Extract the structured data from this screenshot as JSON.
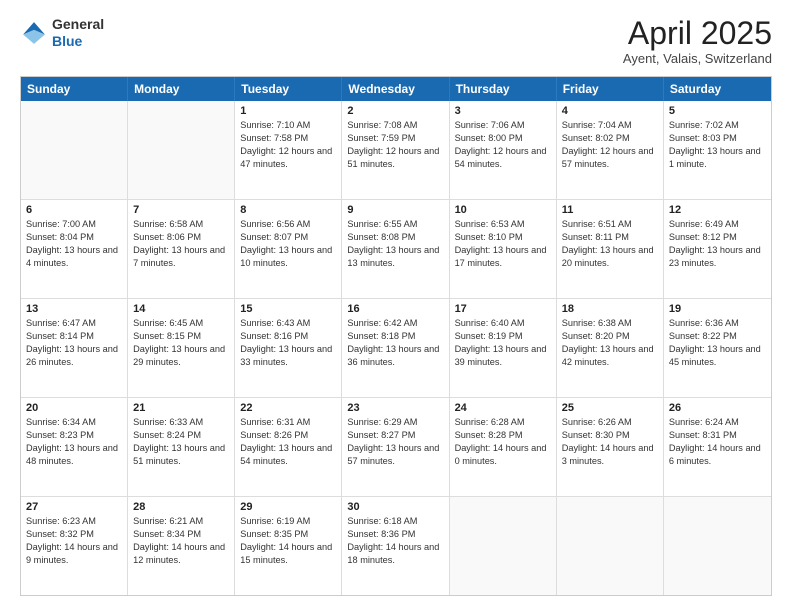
{
  "header": {
    "logo_general": "General",
    "logo_blue": "Blue",
    "month_title": "April 2025",
    "location": "Ayent, Valais, Switzerland"
  },
  "days_of_week": [
    "Sunday",
    "Monday",
    "Tuesday",
    "Wednesday",
    "Thursday",
    "Friday",
    "Saturday"
  ],
  "weeks": [
    [
      {
        "day": "",
        "sunrise": "",
        "sunset": "",
        "daylight": ""
      },
      {
        "day": "",
        "sunrise": "",
        "sunset": "",
        "daylight": ""
      },
      {
        "day": "1",
        "sunrise": "Sunrise: 7:10 AM",
        "sunset": "Sunset: 7:58 PM",
        "daylight": "Daylight: 12 hours and 47 minutes."
      },
      {
        "day": "2",
        "sunrise": "Sunrise: 7:08 AM",
        "sunset": "Sunset: 7:59 PM",
        "daylight": "Daylight: 12 hours and 51 minutes."
      },
      {
        "day": "3",
        "sunrise": "Sunrise: 7:06 AM",
        "sunset": "Sunset: 8:00 PM",
        "daylight": "Daylight: 12 hours and 54 minutes."
      },
      {
        "day": "4",
        "sunrise": "Sunrise: 7:04 AM",
        "sunset": "Sunset: 8:02 PM",
        "daylight": "Daylight: 12 hours and 57 minutes."
      },
      {
        "day": "5",
        "sunrise": "Sunrise: 7:02 AM",
        "sunset": "Sunset: 8:03 PM",
        "daylight": "Daylight: 13 hours and 1 minute."
      }
    ],
    [
      {
        "day": "6",
        "sunrise": "Sunrise: 7:00 AM",
        "sunset": "Sunset: 8:04 PM",
        "daylight": "Daylight: 13 hours and 4 minutes."
      },
      {
        "day": "7",
        "sunrise": "Sunrise: 6:58 AM",
        "sunset": "Sunset: 8:06 PM",
        "daylight": "Daylight: 13 hours and 7 minutes."
      },
      {
        "day": "8",
        "sunrise": "Sunrise: 6:56 AM",
        "sunset": "Sunset: 8:07 PM",
        "daylight": "Daylight: 13 hours and 10 minutes."
      },
      {
        "day": "9",
        "sunrise": "Sunrise: 6:55 AM",
        "sunset": "Sunset: 8:08 PM",
        "daylight": "Daylight: 13 hours and 13 minutes."
      },
      {
        "day": "10",
        "sunrise": "Sunrise: 6:53 AM",
        "sunset": "Sunset: 8:10 PM",
        "daylight": "Daylight: 13 hours and 17 minutes."
      },
      {
        "day": "11",
        "sunrise": "Sunrise: 6:51 AM",
        "sunset": "Sunset: 8:11 PM",
        "daylight": "Daylight: 13 hours and 20 minutes."
      },
      {
        "day": "12",
        "sunrise": "Sunrise: 6:49 AM",
        "sunset": "Sunset: 8:12 PM",
        "daylight": "Daylight: 13 hours and 23 minutes."
      }
    ],
    [
      {
        "day": "13",
        "sunrise": "Sunrise: 6:47 AM",
        "sunset": "Sunset: 8:14 PM",
        "daylight": "Daylight: 13 hours and 26 minutes."
      },
      {
        "day": "14",
        "sunrise": "Sunrise: 6:45 AM",
        "sunset": "Sunset: 8:15 PM",
        "daylight": "Daylight: 13 hours and 29 minutes."
      },
      {
        "day": "15",
        "sunrise": "Sunrise: 6:43 AM",
        "sunset": "Sunset: 8:16 PM",
        "daylight": "Daylight: 13 hours and 33 minutes."
      },
      {
        "day": "16",
        "sunrise": "Sunrise: 6:42 AM",
        "sunset": "Sunset: 8:18 PM",
        "daylight": "Daylight: 13 hours and 36 minutes."
      },
      {
        "day": "17",
        "sunrise": "Sunrise: 6:40 AM",
        "sunset": "Sunset: 8:19 PM",
        "daylight": "Daylight: 13 hours and 39 minutes."
      },
      {
        "day": "18",
        "sunrise": "Sunrise: 6:38 AM",
        "sunset": "Sunset: 8:20 PM",
        "daylight": "Daylight: 13 hours and 42 minutes."
      },
      {
        "day": "19",
        "sunrise": "Sunrise: 6:36 AM",
        "sunset": "Sunset: 8:22 PM",
        "daylight": "Daylight: 13 hours and 45 minutes."
      }
    ],
    [
      {
        "day": "20",
        "sunrise": "Sunrise: 6:34 AM",
        "sunset": "Sunset: 8:23 PM",
        "daylight": "Daylight: 13 hours and 48 minutes."
      },
      {
        "day": "21",
        "sunrise": "Sunrise: 6:33 AM",
        "sunset": "Sunset: 8:24 PM",
        "daylight": "Daylight: 13 hours and 51 minutes."
      },
      {
        "day": "22",
        "sunrise": "Sunrise: 6:31 AM",
        "sunset": "Sunset: 8:26 PM",
        "daylight": "Daylight: 13 hours and 54 minutes."
      },
      {
        "day": "23",
        "sunrise": "Sunrise: 6:29 AM",
        "sunset": "Sunset: 8:27 PM",
        "daylight": "Daylight: 13 hours and 57 minutes."
      },
      {
        "day": "24",
        "sunrise": "Sunrise: 6:28 AM",
        "sunset": "Sunset: 8:28 PM",
        "daylight": "Daylight: 14 hours and 0 minutes."
      },
      {
        "day": "25",
        "sunrise": "Sunrise: 6:26 AM",
        "sunset": "Sunset: 8:30 PM",
        "daylight": "Daylight: 14 hours and 3 minutes."
      },
      {
        "day": "26",
        "sunrise": "Sunrise: 6:24 AM",
        "sunset": "Sunset: 8:31 PM",
        "daylight": "Daylight: 14 hours and 6 minutes."
      }
    ],
    [
      {
        "day": "27",
        "sunrise": "Sunrise: 6:23 AM",
        "sunset": "Sunset: 8:32 PM",
        "daylight": "Daylight: 14 hours and 9 minutes."
      },
      {
        "day": "28",
        "sunrise": "Sunrise: 6:21 AM",
        "sunset": "Sunset: 8:34 PM",
        "daylight": "Daylight: 14 hours and 12 minutes."
      },
      {
        "day": "29",
        "sunrise": "Sunrise: 6:19 AM",
        "sunset": "Sunset: 8:35 PM",
        "daylight": "Daylight: 14 hours and 15 minutes."
      },
      {
        "day": "30",
        "sunrise": "Sunrise: 6:18 AM",
        "sunset": "Sunset: 8:36 PM",
        "daylight": "Daylight: 14 hours and 18 minutes."
      },
      {
        "day": "",
        "sunrise": "",
        "sunset": "",
        "daylight": ""
      },
      {
        "day": "",
        "sunrise": "",
        "sunset": "",
        "daylight": ""
      },
      {
        "day": "",
        "sunrise": "",
        "sunset": "",
        "daylight": ""
      }
    ]
  ]
}
